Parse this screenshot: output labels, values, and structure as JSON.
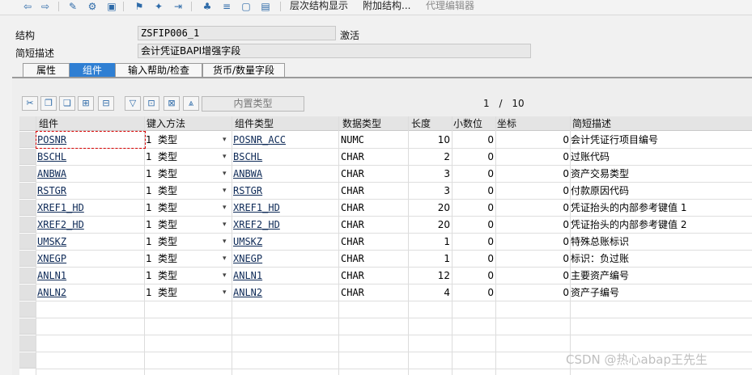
{
  "toolbar": {
    "hierarchy_label": "层次结构显示",
    "append_label": "附加结构...",
    "proxy_label": "代理编辑器"
  },
  "header": {
    "structure_label": "结构",
    "structure_value": "ZSFIP006_1",
    "status": "激活",
    "desc_label": "简短描述",
    "desc_value": "会计凭证BAPI增强字段"
  },
  "tabs": [
    {
      "label": "属性"
    },
    {
      "label": "组件"
    },
    {
      "label": "输入帮助/检查"
    },
    {
      "label": "货币/数量字段"
    }
  ],
  "table_toolbar": {
    "builtin_type_label": "内置类型"
  },
  "pager": {
    "current": "1",
    "separator": "/",
    "total": "10"
  },
  "columns": {
    "component": "组件",
    "entry_method": "键入方法",
    "component_type": "组件类型",
    "data_type": "数据类型",
    "length": "长度",
    "decimals": "小数位",
    "coordinate": "坐标",
    "short_desc": "简短描述"
  },
  "rows": [
    {
      "component": "POSNR",
      "flag": "1",
      "method": "类型",
      "ctype": "POSNR_ACC",
      "dtype": "NUMC",
      "len": "10",
      "dec": "0",
      "coord": "0",
      "desc": "会计凭证行项目编号"
    },
    {
      "component": "BSCHL",
      "flag": "1",
      "method": "类型",
      "ctype": "BSCHL",
      "dtype": "CHAR",
      "len": "2",
      "dec": "0",
      "coord": "0",
      "desc": "过账代码"
    },
    {
      "component": "ANBWA",
      "flag": "1",
      "method": "类型",
      "ctype": "ANBWA",
      "dtype": "CHAR",
      "len": "3",
      "dec": "0",
      "coord": "0",
      "desc": "资产交易类型"
    },
    {
      "component": "RSTGR",
      "flag": "1",
      "method": "类型",
      "ctype": "RSTGR",
      "dtype": "CHAR",
      "len": "3",
      "dec": "0",
      "coord": "0",
      "desc": "付款原因代码"
    },
    {
      "component": "XREF1_HD",
      "flag": "1",
      "method": "类型",
      "ctype": "XREF1_HD",
      "dtype": "CHAR",
      "len": "20",
      "dec": "0",
      "coord": "0",
      "desc": "凭证抬头的内部参考键值 1"
    },
    {
      "component": "XREF2_HD",
      "flag": "1",
      "method": "类型",
      "ctype": "XREF2_HD",
      "dtype": "CHAR",
      "len": "20",
      "dec": "0",
      "coord": "0",
      "desc": "凭证抬头的内部参考键值 2"
    },
    {
      "component": "UMSKZ",
      "flag": "1",
      "method": "类型",
      "ctype": "UMSKZ",
      "dtype": "CHAR",
      "len": "1",
      "dec": "0",
      "coord": "0",
      "desc": "特殊总账标识"
    },
    {
      "component": "XNEGP",
      "flag": "1",
      "method": "类型",
      "ctype": "XNEGP",
      "dtype": "CHAR",
      "len": "1",
      "dec": "0",
      "coord": "0",
      "desc": "标识：负过账"
    },
    {
      "component": "ANLN1",
      "flag": "1",
      "method": "类型",
      "ctype": "ANLN1",
      "dtype": "CHAR",
      "len": "12",
      "dec": "0",
      "coord": "0",
      "desc": "主要资产编号"
    },
    {
      "component": "ANLN2",
      "flag": "1",
      "method": "类型",
      "ctype": "ANLN2",
      "dtype": "CHAR",
      "len": "4",
      "dec": "0",
      "coord": "0",
      "desc": "资产子编号"
    }
  ],
  "watermark": "CSDN @热心abap王先生",
  "colors": {
    "active_tab": "#2f7fd3",
    "icon_blue": "#2d6aa8"
  }
}
